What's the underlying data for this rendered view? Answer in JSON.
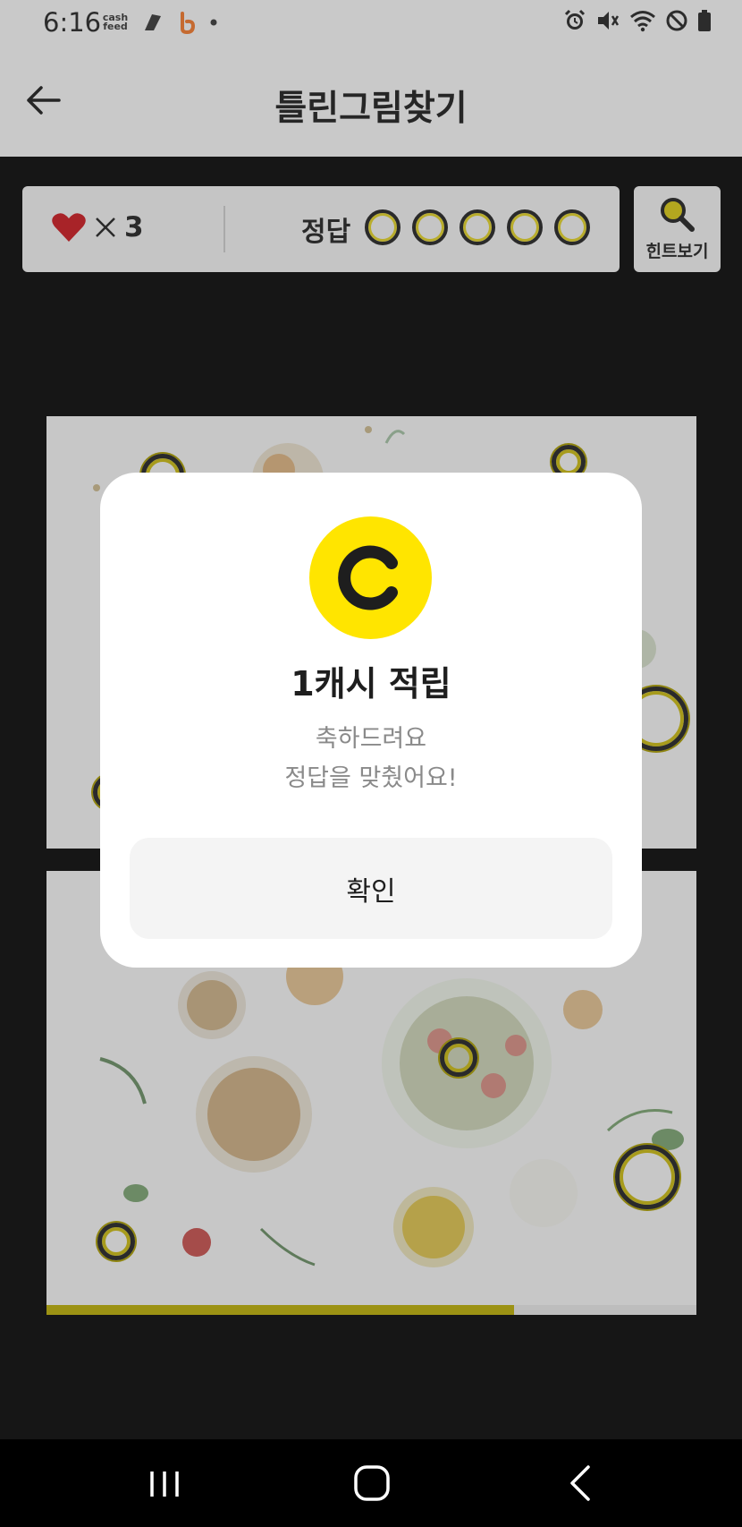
{
  "status_bar": {
    "time": "6:16",
    "cashfeed_icon_text": "cash feed",
    "icons_left": [
      "cashfeed-icon",
      "app-icon",
      "b-icon",
      "dot-icon"
    ],
    "icons_right": [
      "alarm-icon",
      "vibrate-icon",
      "wifi-icon",
      "do-not-disturb-icon",
      "battery-icon"
    ]
  },
  "app_bar": {
    "title": "틀린그림찾기"
  },
  "info_bar": {
    "lives_count": "3",
    "answer_label": "정답",
    "answer_slots": 5
  },
  "hint_button": {
    "label": "힌트보기"
  },
  "progress": {
    "fraction": 0.72
  },
  "dialog": {
    "coin_letter": "C",
    "title": "1캐시 적립",
    "message_line1": "축하드려요",
    "message_line2": "정답을 맞췄어요!",
    "confirm_label": "확인"
  },
  "colors": {
    "accent_yellow": "#ffe500",
    "marker_yellow": "#a79b1c",
    "heart_red": "#c1272d",
    "overlay_bg": "#161616"
  }
}
